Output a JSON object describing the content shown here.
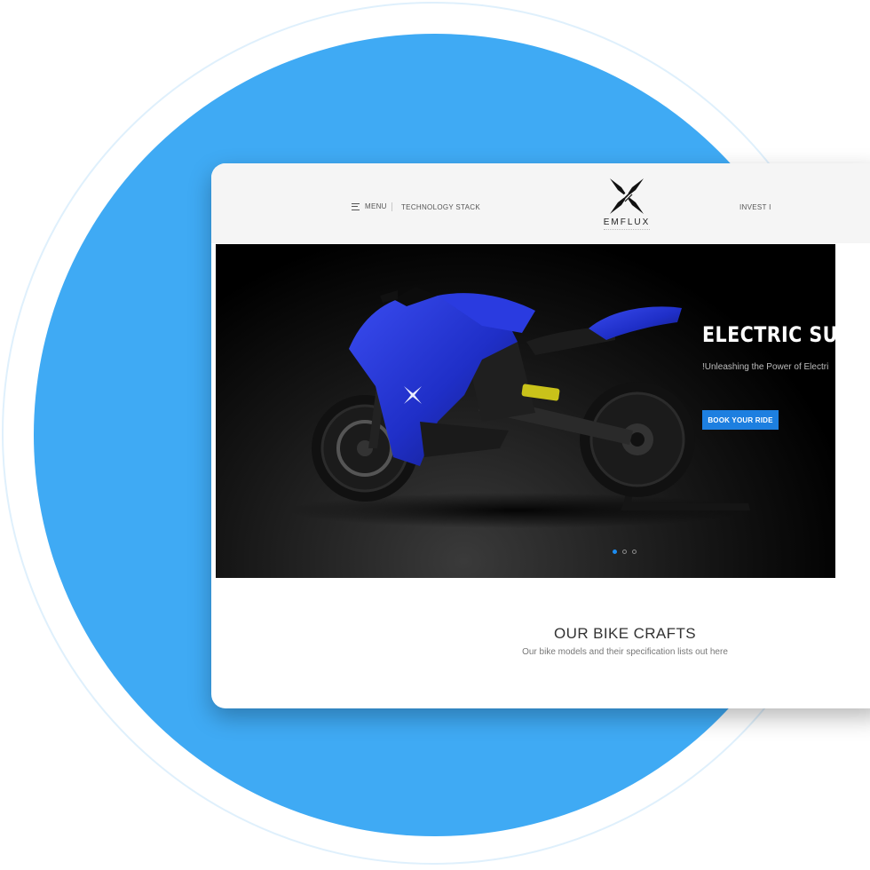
{
  "nav": {
    "menu_label": "MENU",
    "tech_label": "TECHNOLOGY STACK",
    "invest_label": "INVEST I"
  },
  "logo": {
    "text": "EMFLUX"
  },
  "hero": {
    "title": "ELECTRIC SUP",
    "subtitle": "!Unleashing the Power of Electri",
    "cta_label": "BOOK YOUR RIDE"
  },
  "slider": {
    "current": 1,
    "total": 3
  },
  "section": {
    "title": "OUR BIKE CRAFTS",
    "subtitle": "Our bike models and their specification lists out here"
  },
  "colors": {
    "background_circle": "#3faaf4",
    "accent": "#1d7fe0",
    "bike_body": "#1f2fc8"
  }
}
